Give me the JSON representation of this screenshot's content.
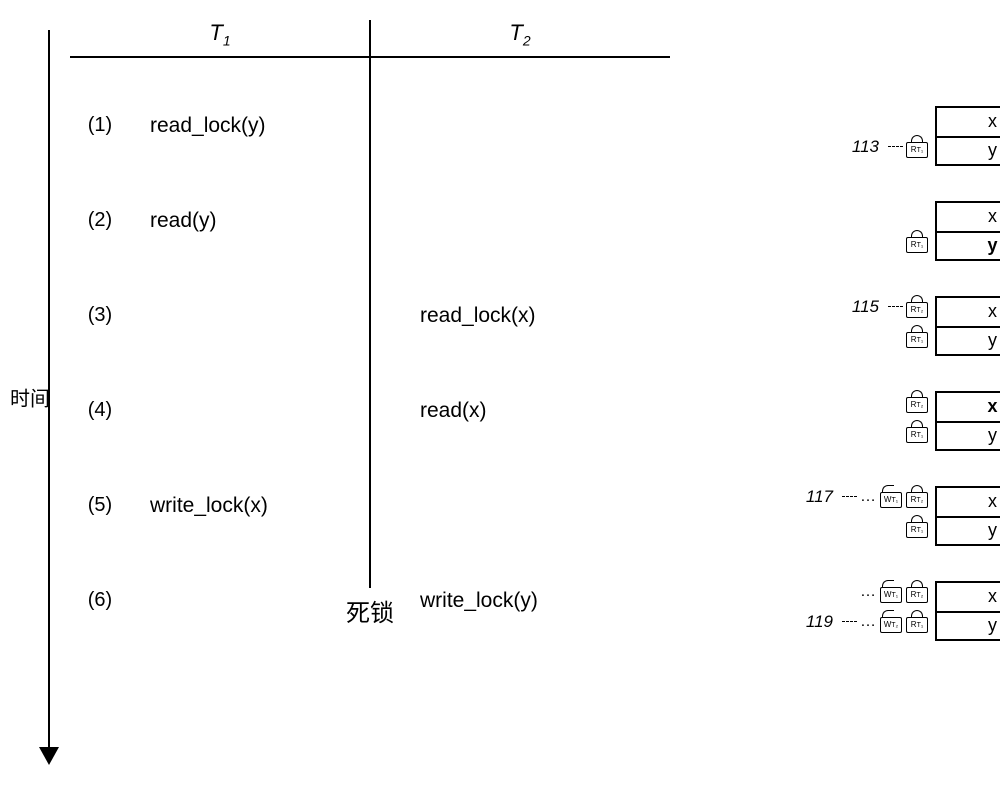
{
  "timeAxis": {
    "label": "时间"
  },
  "header": {
    "col1": "T",
    "col1_sub": "1",
    "col2": "T",
    "col2_sub": "2"
  },
  "rows": [
    {
      "num": "(1)",
      "t1": "read_lock(y)",
      "t2": ""
    },
    {
      "num": "(2)",
      "t1": "read(y)",
      "t2": ""
    },
    {
      "num": "(3)",
      "t1": "",
      "t2": "read_lock(x)"
    },
    {
      "num": "(4)",
      "t1": "",
      "t2": "read(x)"
    },
    {
      "num": "(5)",
      "t1": "write_lock(x)",
      "t2": ""
    },
    {
      "num": "(6)",
      "t1": "",
      "t2": "write_lock(y)"
    }
  ],
  "deadlock": "死锁",
  "refs": {
    "r113": "113",
    "r115": "115",
    "r117": "117",
    "r119": "119"
  },
  "data_items": {
    "x": "x",
    "y": "y"
  },
  "lock_labels": {
    "rt1": "R",
    "rt2": "R",
    "wt1": "W",
    "wt2": "W"
  },
  "lock_subs": {
    "t1": "T₁",
    "t2": "T₂"
  }
}
